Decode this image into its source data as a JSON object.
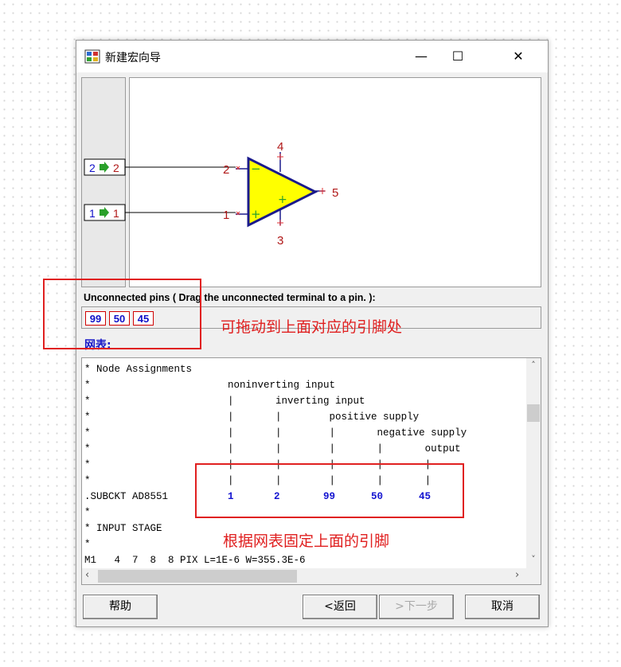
{
  "window": {
    "title": "新建宏向导",
    "minimize_glyph": "—",
    "maximize_glyph": "☐",
    "close_glyph": "✕"
  },
  "schematic": {
    "pin_blocks": [
      {
        "left": "2",
        "right": "2"
      },
      {
        "left": "1",
        "right": "1"
      }
    ],
    "pin_numbers": {
      "in_minus": "2",
      "in_plus": "1",
      "pos_supply": "4",
      "neg_supply": "3",
      "output": "5"
    },
    "symbols": {
      "minus": "−",
      "plus": "+",
      "center_plus": "+"
    },
    "colors": {
      "triangle_fill": "#ffff00",
      "triangle_stroke": "#1a1a8c",
      "pin_number": "#b01818",
      "arrow": "#2aa02a",
      "block_number": "#1010c8"
    }
  },
  "unconnected": {
    "label": "Unconnected pins ( Drag the unconnected terminal to a pin. ):",
    "pins": [
      "99",
      "50",
      "45"
    ]
  },
  "netlist": {
    "label": "网表:",
    "lines": [
      "* Node Assignments",
      "*                       noninverting input",
      "*                       |       inverting input",
      "*                       |       |        positive supply",
      "*                       |       |        |       negative supply",
      "*                       |       |        |       |       output",
      "*                       |       |        |       |       |",
      "*                       |       |        |       |       |",
      "",
      "*",
      "* INPUT STAGE",
      "*",
      "M1   4  7  8  8 PIX L=1E-6 W=355.3E-6"
    ],
    "subckt": {
      "keyword": ".SUBCKT AD8551",
      "nodes": [
        "1",
        "2",
        "99",
        "50",
        "45"
      ]
    },
    "scroll_up": "˄",
    "scroll_down": "˅",
    "scroll_left": "‹",
    "scroll_right": "›"
  },
  "buttons": {
    "help": "帮助",
    "back": "<返回",
    "next": ">下一步",
    "cancel": "取消"
  },
  "annotations": {
    "drag_hint": "可拖动到上面对应的引脚处",
    "fix_hint": "根据网表固定上面的引脚",
    "color": "#e02020"
  }
}
